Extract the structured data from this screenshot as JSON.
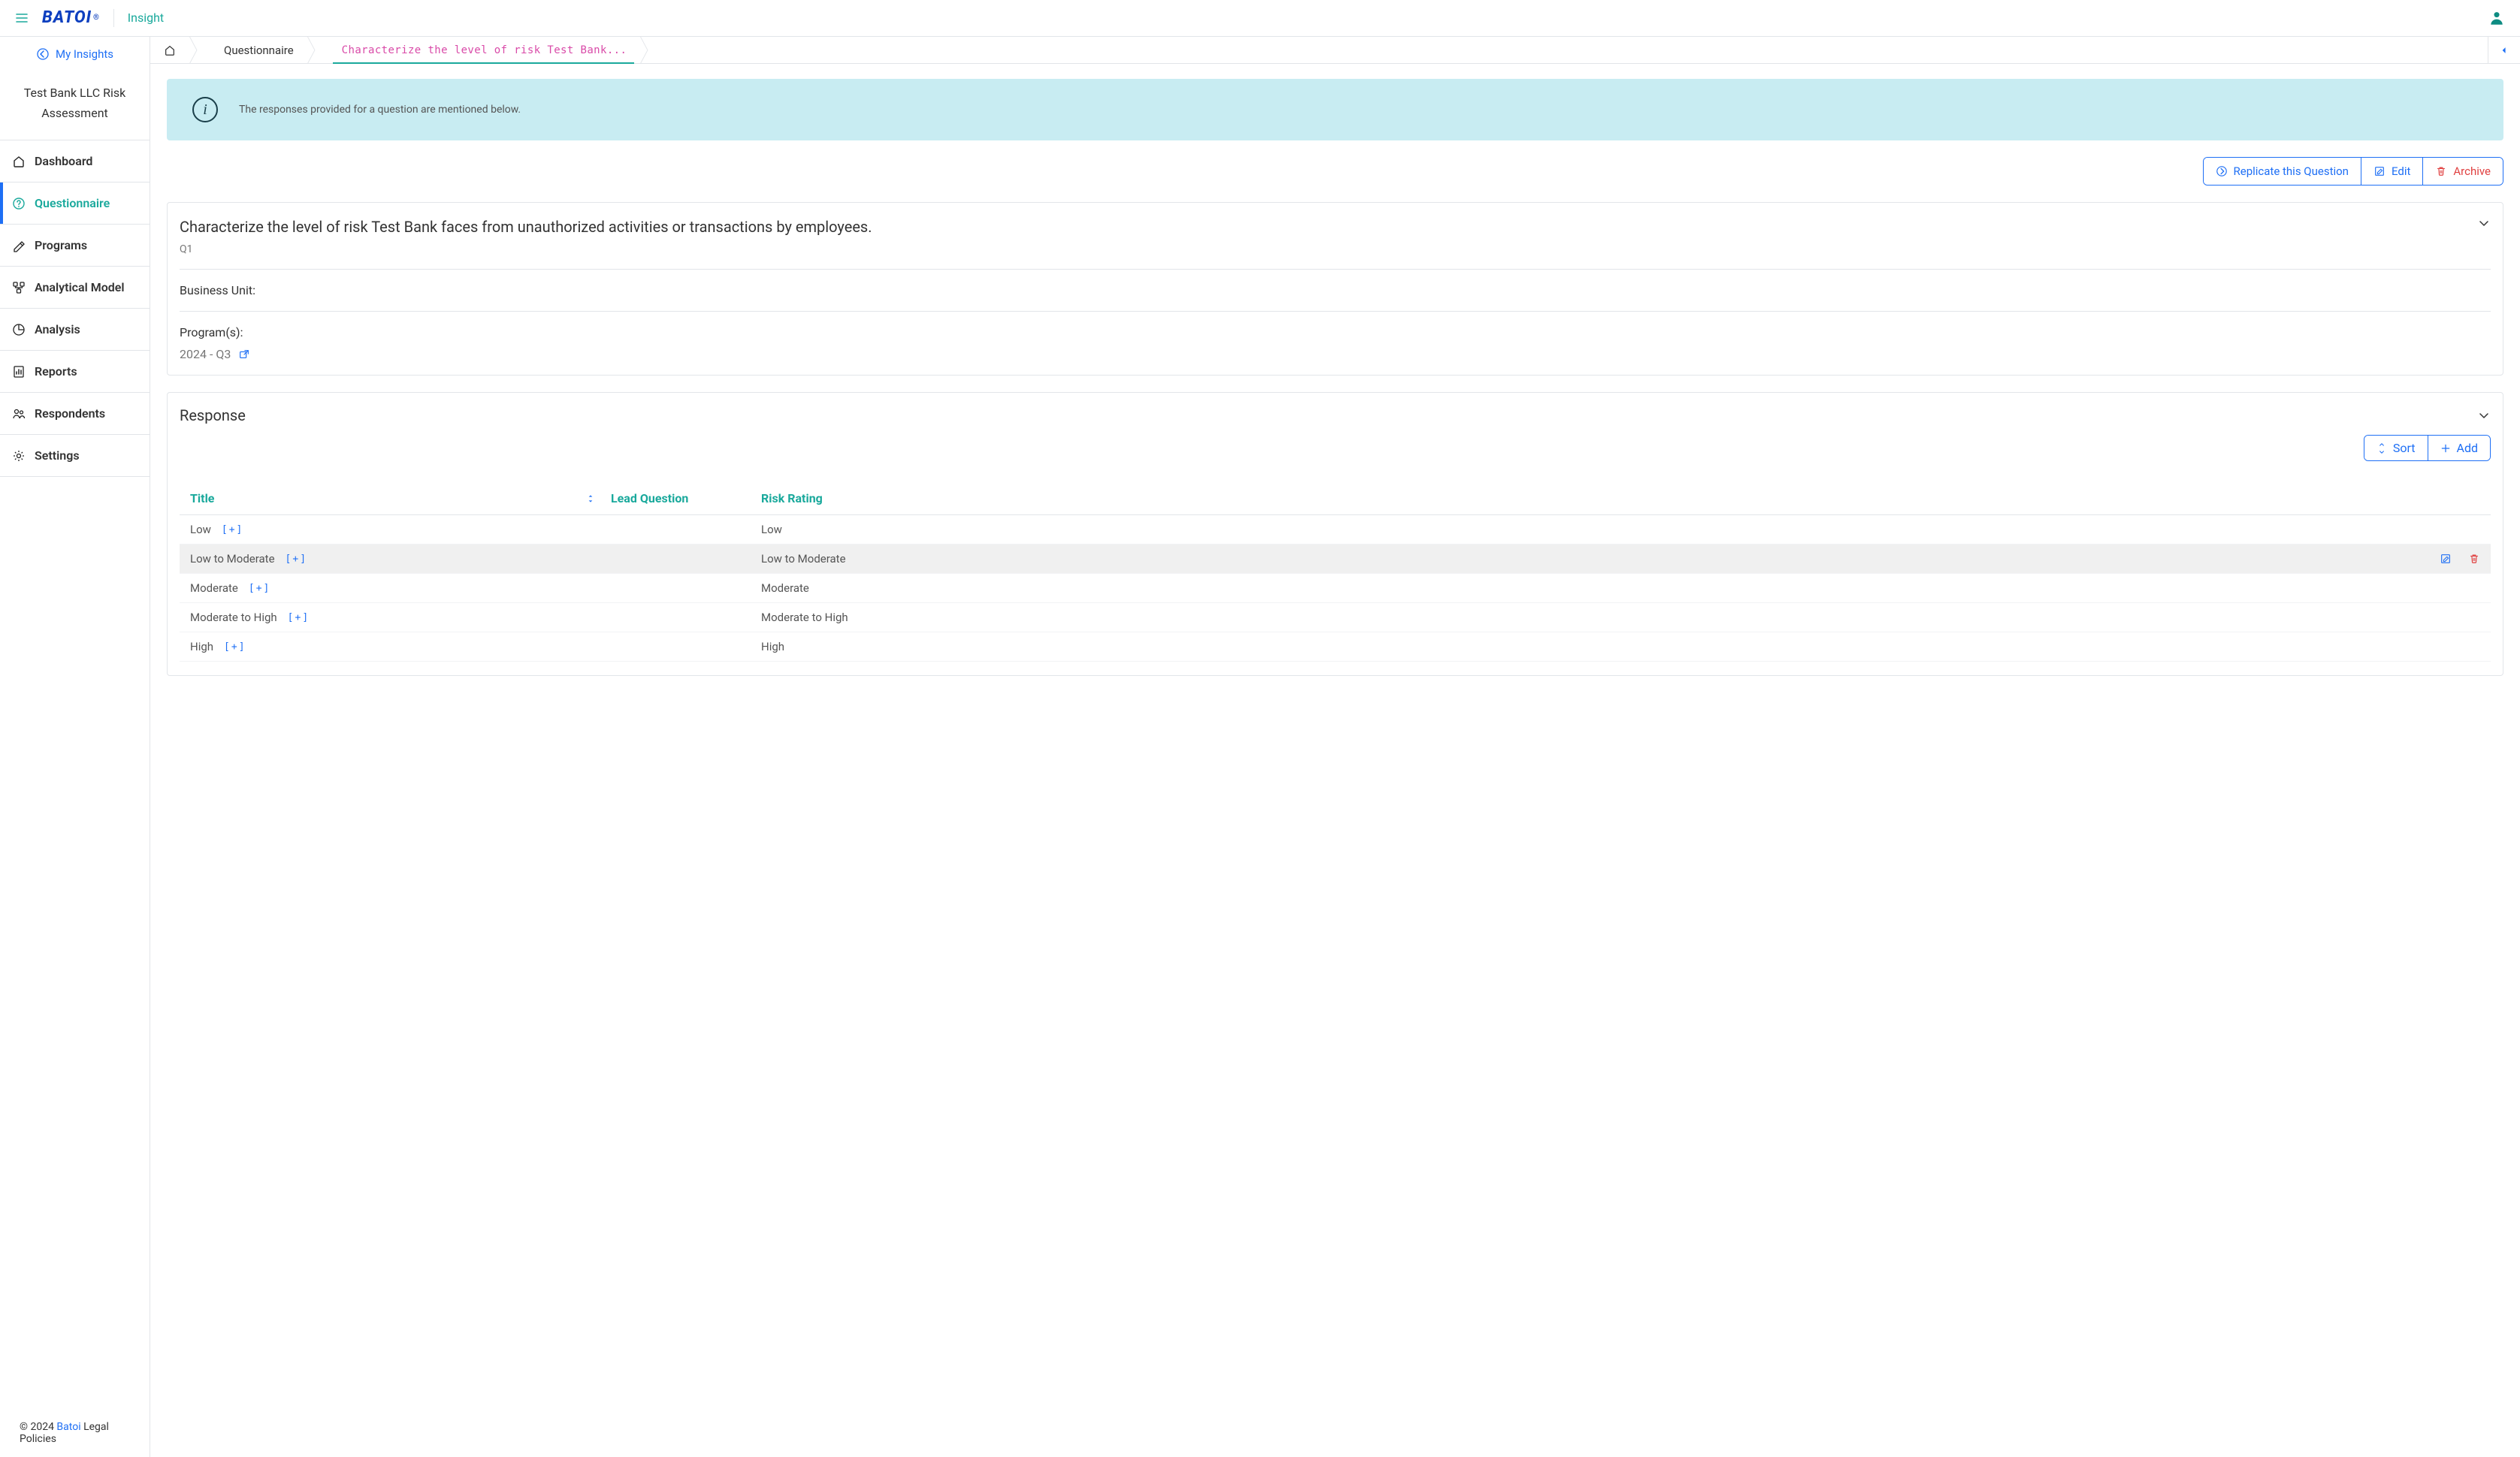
{
  "header": {
    "logo_text": "BATOI",
    "app_name": "Insight"
  },
  "sidebar": {
    "my_insights": "My Insights",
    "project_name": "Test Bank LLC Risk Assessment",
    "items": [
      {
        "label": "Dashboard",
        "icon": "home-icon"
      },
      {
        "label": "Questionnaire",
        "icon": "question-circle-icon",
        "active": true
      },
      {
        "label": "Programs",
        "icon": "pen-edit-icon"
      },
      {
        "label": "Analytical Model",
        "icon": "model-icon"
      },
      {
        "label": "Analysis",
        "icon": "pie-icon"
      },
      {
        "label": "Reports",
        "icon": "bar-doc-icon"
      },
      {
        "label": "Respondents",
        "icon": "users-icon"
      },
      {
        "label": "Settings",
        "icon": "gear-icon"
      }
    ],
    "footer_prefix": "© 2024 ",
    "footer_brand": "Batoi",
    "footer_suffix": " Legal Policies"
  },
  "breadcrumb": {
    "items": [
      {
        "label": "",
        "home": true
      },
      {
        "label": "Questionnaire"
      },
      {
        "label": "Characterize the level of risk Test Bank...",
        "current": true
      }
    ]
  },
  "banner": {
    "text": "The responses provided for a question are mentioned below."
  },
  "action_buttons": {
    "replicate": "Replicate this Question",
    "edit": "Edit",
    "archive": "Archive"
  },
  "question": {
    "title": "Characterize the level of risk Test Bank faces from unauthorized activities or transactions by employees.",
    "code": "Q1",
    "business_unit_label": "Business Unit:",
    "programs_label": "Program(s):",
    "program_value": "2024 - Q3"
  },
  "response": {
    "title": "Response",
    "sort_label": "Sort",
    "add_label": "Add",
    "columns": {
      "title": "Title",
      "lead": "Lead Question",
      "risk": "Risk Rating"
    },
    "expand_symbol": "[+]",
    "rows": [
      {
        "title": "Low",
        "lead": "",
        "risk": "Low",
        "active": false
      },
      {
        "title": "Low to Moderate",
        "lead": "",
        "risk": "Low to Moderate",
        "active": true
      },
      {
        "title": "Moderate",
        "lead": "",
        "risk": "Moderate",
        "active": false
      },
      {
        "title": "Moderate to High",
        "lead": "",
        "risk": "Moderate to High",
        "active": false
      },
      {
        "title": "High",
        "lead": "",
        "risk": "High",
        "active": false
      }
    ]
  }
}
